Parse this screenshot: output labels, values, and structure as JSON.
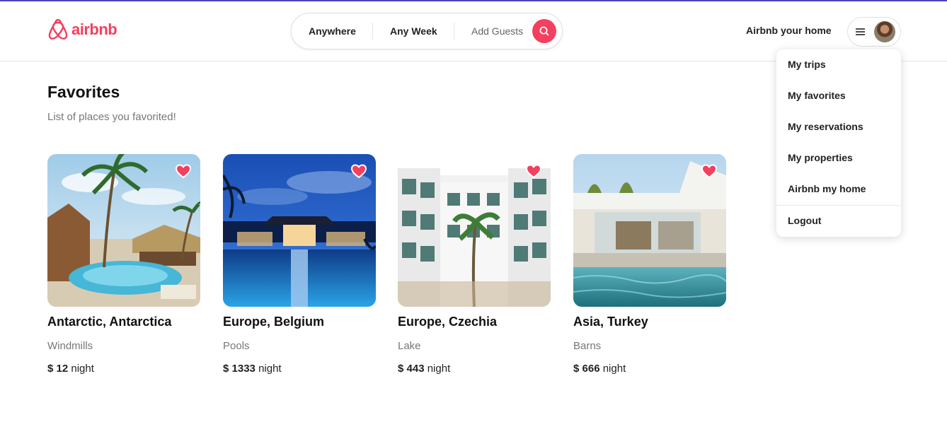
{
  "brand": {
    "name": "airbnb",
    "color": "#f43f5e"
  },
  "search": {
    "where_label": "Anywhere",
    "when_label": "Any Week",
    "guests_label": "Add Guests",
    "button_icon": "search-icon"
  },
  "header": {
    "host_link": "Airbnb your home",
    "menu_icon": "hamburger-icon"
  },
  "user_menu": {
    "items": [
      "My trips",
      "My favorites",
      "My reservations",
      "My properties",
      "Airbnb my home",
      "Logout"
    ]
  },
  "page": {
    "title": "Favorites",
    "subtitle": "List of places you favorited!"
  },
  "listings": [
    {
      "location": "Antarctic, Antarctica",
      "category": "Windmills",
      "currency": "$",
      "price": "12",
      "unit": "night",
      "favorited": true
    },
    {
      "location": "Europe, Belgium",
      "category": "Pools",
      "currency": "$",
      "price": "1333",
      "unit": "night",
      "favorited": true
    },
    {
      "location": "Europe, Czechia",
      "category": "Lake",
      "currency": "$",
      "price": "443",
      "unit": "night",
      "favorited": true
    },
    {
      "location": "Asia, Turkey",
      "category": "Barns",
      "currency": "$",
      "price": "666",
      "unit": "night",
      "favorited": true
    }
  ]
}
